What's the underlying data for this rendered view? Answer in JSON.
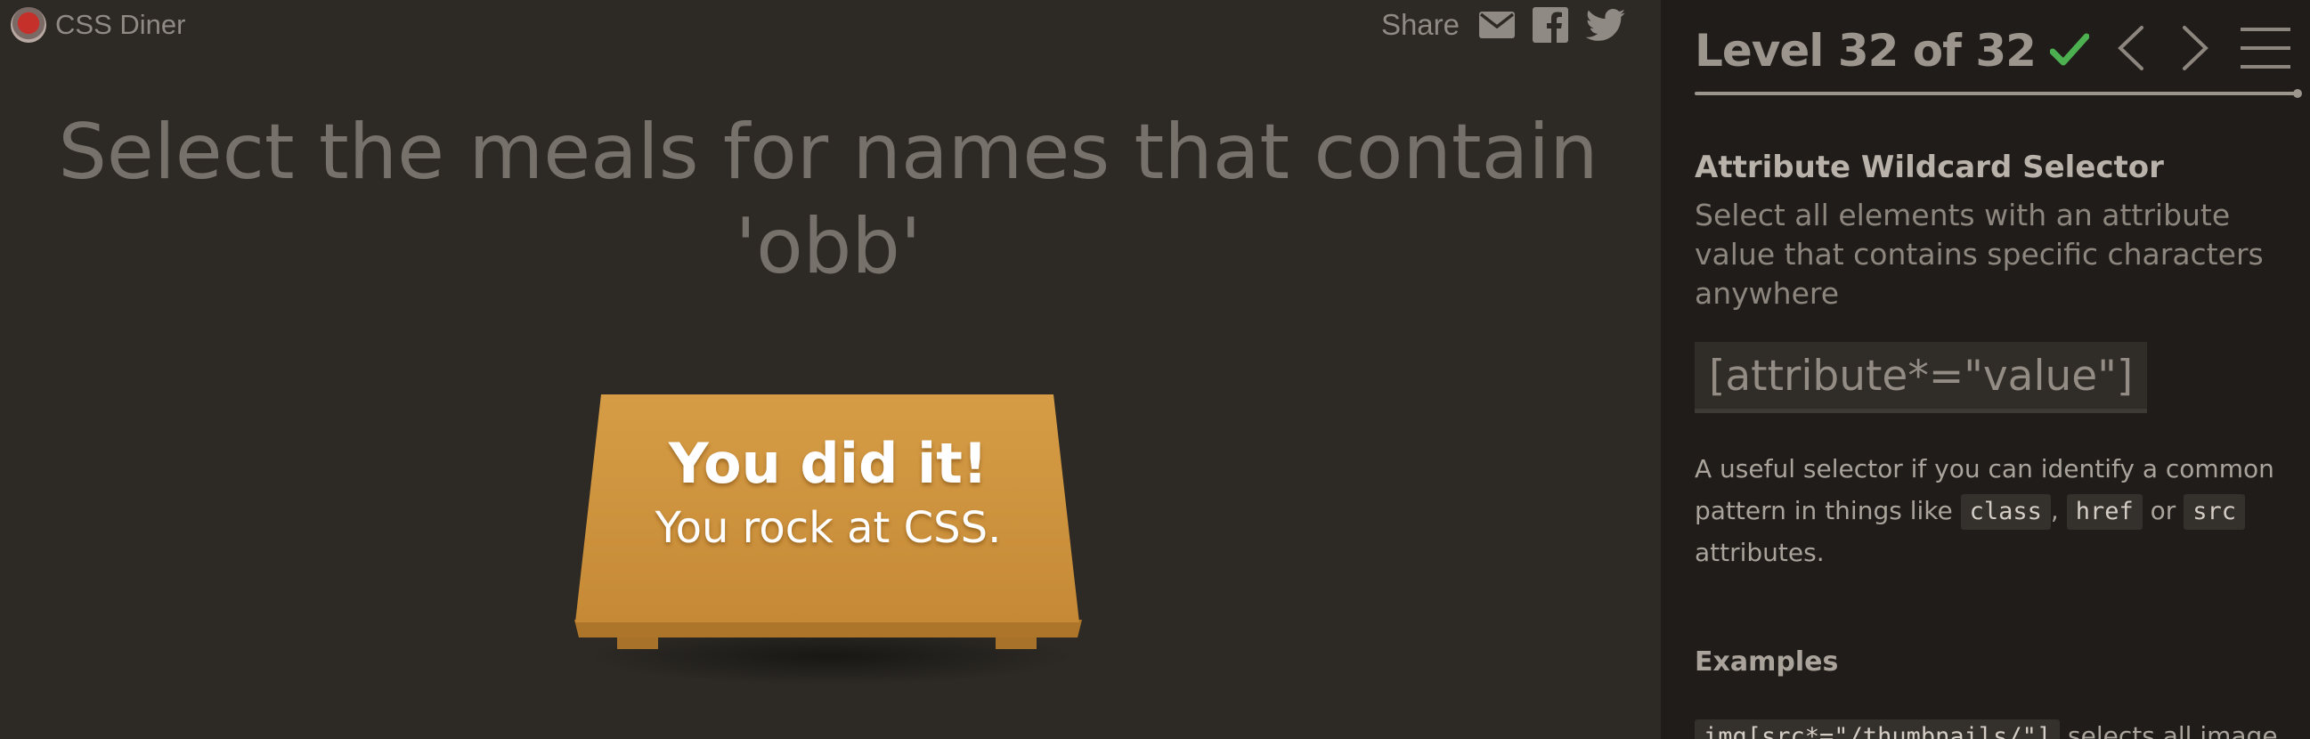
{
  "app": {
    "title": "CSS Diner"
  },
  "share": {
    "label": "Share",
    "icons": [
      "envelope-icon",
      "facebook-icon",
      "twitter-icon"
    ]
  },
  "instruction": {
    "line1": "Select the meals for names that contain",
    "line2": "'obb'"
  },
  "table": {
    "title": "You did it!",
    "subtitle": "You rock at CSS."
  },
  "sidebar": {
    "level_text": "Level 32 of 32",
    "level_complete": true,
    "progress_fraction": 1.0,
    "nav": {
      "prev_icon": "chevron-left-icon",
      "next_icon": "chevron-right-icon",
      "menu_icon": "hamburger-menu-icon"
    },
    "selector_name": "Attribute Wildcard Selector",
    "description": "Select all elements with an attribute value that contains specific characters anywhere",
    "syntax": "[attribute*=\"value\"]",
    "hint": {
      "part1": "A useful selector if you can identify a common pattern in things like",
      "code1": "class",
      "sep1": ",",
      "code2": "href",
      "sep2": "or",
      "code3": "src",
      "part2": "attributes."
    },
    "examples_title": "Examples",
    "example_1": {
      "code": "img[src*=\"/thumbnails/\"]",
      "text": "selects all image"
    }
  },
  "colors": {
    "game_bg": "#2d2a25",
    "sidebar_bg": "#1f1c19",
    "table_top": "#d39a45",
    "check_green": "#4caf50"
  }
}
